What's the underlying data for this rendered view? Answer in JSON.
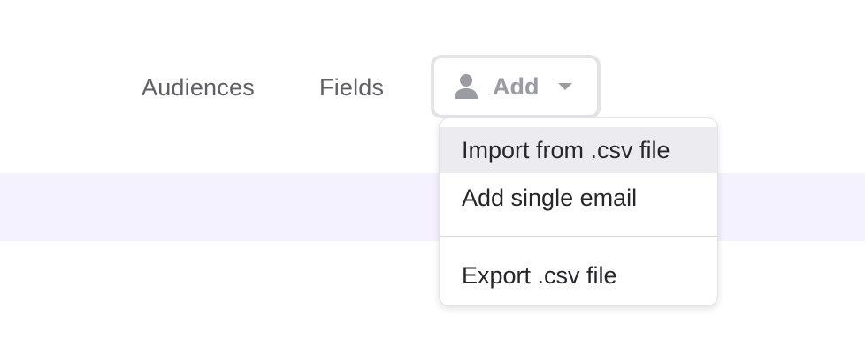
{
  "nav": {
    "audiences_label": "Audiences",
    "fields_label": "Fields",
    "add_label": "Add"
  },
  "icons": {
    "add_button_icon": "user-icon",
    "add_button_caret": "caret-down-icon"
  },
  "dropdown": {
    "items": [
      {
        "label": "Import from .csv file",
        "highlighted": true
      },
      {
        "label": "Add single email",
        "highlighted": false
      },
      {
        "label": "Export .csv file",
        "highlighted": false
      }
    ]
  },
  "colors": {
    "banner_background": "#f5f2ff",
    "nav_text": "#5f5f66",
    "add_button_text": "#9b9ba3",
    "menu_highlight": "#ececf0"
  }
}
